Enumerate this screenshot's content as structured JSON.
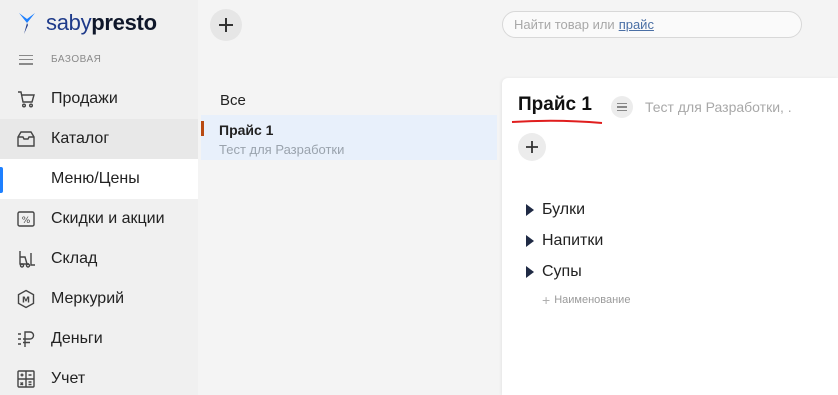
{
  "app": {
    "brand_light": "saby",
    "brand_bold": "presto",
    "brand_color": "#1e3a8a"
  },
  "sidebar": {
    "tariff_label": "БАЗОВАЯ",
    "items": [
      {
        "label": "Продажи",
        "icon": "cart-icon"
      },
      {
        "label": "Каталог",
        "icon": "catalog-icon"
      },
      {
        "label": "Меню/Цены",
        "icon": ""
      },
      {
        "label": "Скидки и акции",
        "icon": "percent-icon"
      },
      {
        "label": "Склад",
        "icon": "forklift-icon"
      },
      {
        "label": "Меркурий",
        "icon": "mercury-icon"
      },
      {
        "label": "Деньги",
        "icon": "ruble-icon"
      },
      {
        "label": "Учет",
        "icon": "calculator-icon"
      }
    ],
    "active_color": "#1e80ff"
  },
  "middle": {
    "all_label": "Все",
    "price_list": {
      "title": "Прайс 1",
      "subtitle": "Тест для Разработки",
      "marker_color": "#b84a12"
    }
  },
  "search": {
    "placeholder": "Найти товар или",
    "link": "прайс"
  },
  "panel": {
    "title": "Прайс 1",
    "org": "Тест для Разработки, .",
    "categories": [
      "Булки",
      "Напитки",
      "Супы"
    ],
    "add_name_label": "Наименование",
    "underline_color": "#e01e1e"
  }
}
